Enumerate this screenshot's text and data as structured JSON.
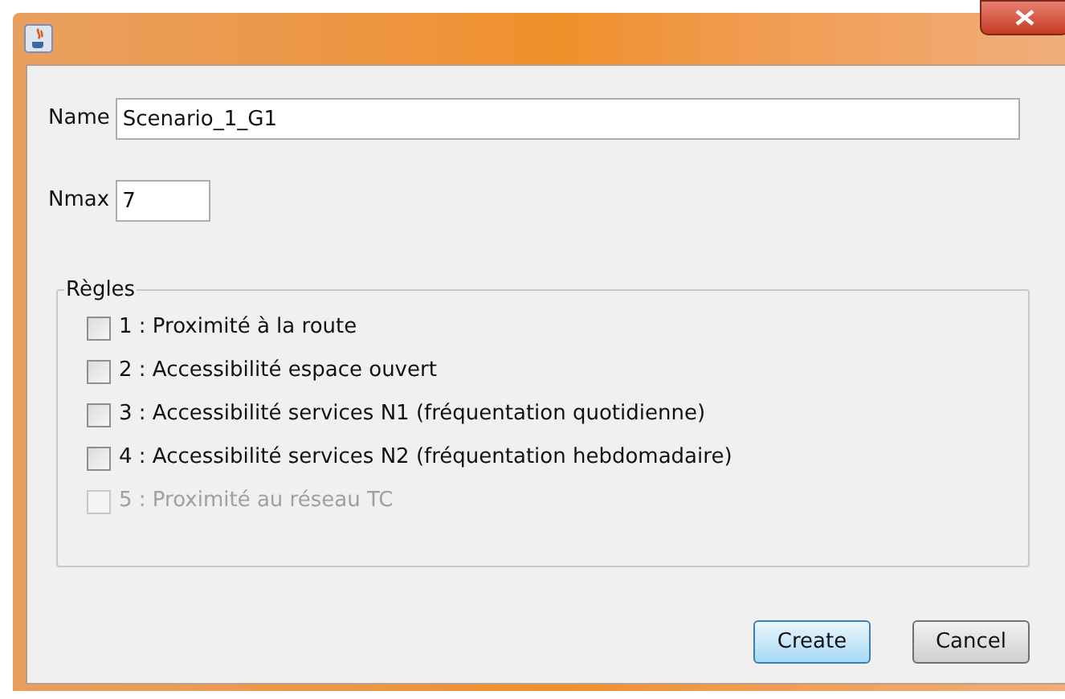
{
  "fields": [
    {
      "label": "Name",
      "value": "Scenario_1_G1",
      "kind": "wide"
    },
    {
      "label": "Nmax",
      "value": "7",
      "kind": "narrow"
    }
  ],
  "rules": {
    "title": "Règles",
    "items": [
      {
        "label": "1 : Proximité à la route",
        "checked": false,
        "disabled": false
      },
      {
        "label": "2 : Accessibilité espace ouvert",
        "checked": false,
        "disabled": false
      },
      {
        "label": "3 : Accessibilité services N1 (fréquentation quotidienne)",
        "checked": false,
        "disabled": false
      },
      {
        "label": "4 : Accessibilité services N2 (fréquentation hebdomadaire)",
        "checked": false,
        "disabled": false
      },
      {
        "label": "5 : Proximité au réseau TC",
        "checked": false,
        "disabled": true
      }
    ]
  },
  "buttons": [
    {
      "label": "Create",
      "default": true
    },
    {
      "label": "Cancel",
      "default": false
    }
  ]
}
